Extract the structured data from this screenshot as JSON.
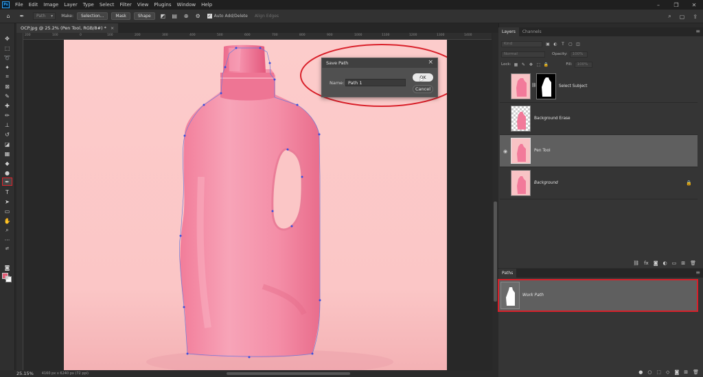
{
  "menu": [
    "File",
    "Edit",
    "Image",
    "Layer",
    "Type",
    "Select",
    "Filter",
    "View",
    "Plugins",
    "Window",
    "Help"
  ],
  "app_logo": "Ps",
  "options": {
    "mode": "Path",
    "make_label": "Make:",
    "selection_btn": "Selection...",
    "mask_btn": "Mask",
    "shape_btn": "Shape",
    "auto_add_delete": "Auto Add/Delete",
    "align_edges": "Align Edges"
  },
  "document_tab": {
    "title": "OCP.jpg @ 25.2% (Pen Tool, RGB/8#) *",
    "close": "×"
  },
  "ruler_ticks": [
    "200",
    "100",
    "0",
    "100",
    "200",
    "300",
    "400",
    "500",
    "600",
    "700",
    "800",
    "900",
    "1000",
    "1100",
    "1200",
    "1300",
    "1400",
    "1500",
    "1600",
    "1700",
    "1800",
    "1900",
    "2000",
    "2100",
    "2200",
    "2300",
    "2400",
    "2500",
    "2600",
    "2700",
    "2800",
    "2900",
    "3000",
    "3100",
    "3200",
    "3300",
    "3400",
    "3500",
    "3600",
    "3700",
    "3800",
    "3900",
    "4000"
  ],
  "status": {
    "zoom": "25.15%",
    "info": "4160 px x 6240 px (72 ppi)"
  },
  "dialog": {
    "title": "Save Path",
    "name_label": "Name:",
    "name_value": "Path 1",
    "ok": "OK",
    "cancel": "Cancel"
  },
  "layers_panel": {
    "tabs": [
      "Layers",
      "Channels"
    ],
    "search_placeholder": "Kind",
    "blend_mode": "Normal",
    "opacity_label": "Opacity:",
    "opacity_value": "100%",
    "lock_label": "Lock:",
    "fill_label": "Fill:",
    "fill_value": "100%",
    "layers": [
      {
        "name": "Select Subject",
        "visible": false,
        "selected": false,
        "italic": false
      },
      {
        "name": "Background Erase",
        "visible": false,
        "selected": false,
        "italic": false
      },
      {
        "name": "Pen Tool",
        "visible": true,
        "selected": true,
        "italic": false
      },
      {
        "name": "Background",
        "visible": false,
        "selected": false,
        "italic": true,
        "locked": true
      }
    ]
  },
  "paths_panel": {
    "tab": "Paths",
    "paths": [
      {
        "name": "Work Path"
      }
    ]
  },
  "colors": {
    "highlight": "#d9202a",
    "bottle_pink": "#f27a9a",
    "canvas_bg": "#fbcaca"
  }
}
